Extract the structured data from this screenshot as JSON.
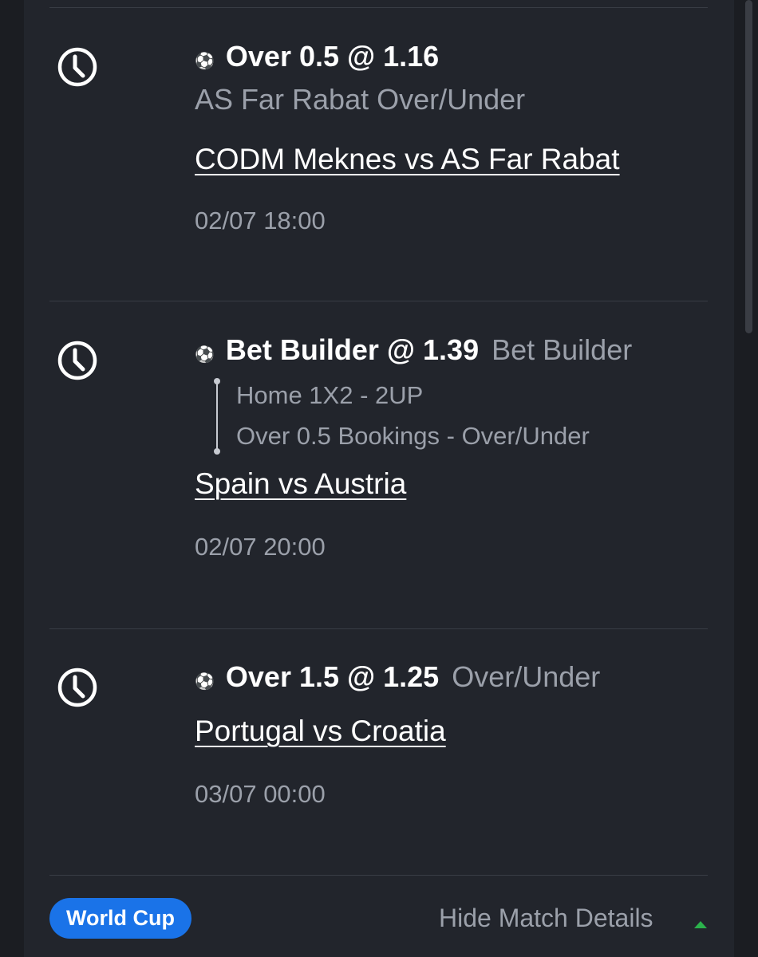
{
  "bets": [
    {
      "clock_icon": "clock-icon",
      "sport_icon": "soccer-ball-icon",
      "selection": "Over 0.5 @ 1.16",
      "market": "AS Far Rabat Over/Under",
      "match": "CODM Meknes vs AS Far Rabat",
      "time": "02/07 18:00"
    },
    {
      "clock_icon": "clock-icon",
      "sport_icon": "soccer-ball-icon",
      "selection": "Bet Builder @ 1.39",
      "market": "Bet Builder",
      "legs": [
        "Home 1X2 - 2UP",
        "Over 0.5 Bookings - Over/Under"
      ],
      "match": "Spain vs Austria",
      "time": "02/07 20:00"
    },
    {
      "clock_icon": "clock-icon",
      "sport_icon": "soccer-ball-icon",
      "selection": "Over 1.5 @ 1.25",
      "market": "Over/Under",
      "match": "Portugal vs Croatia",
      "time": "03/07 00:00"
    }
  ],
  "footer": {
    "badge": "World Cup",
    "toggle_label": "Hide Match Details",
    "toggle_icon": "caret-up-icon"
  },
  "colors": {
    "background": "#1b1d22",
    "card": "#22252c",
    "muted_text": "#9ba0aa",
    "badge": "#1a73e8",
    "caret": "#2bb24c"
  }
}
